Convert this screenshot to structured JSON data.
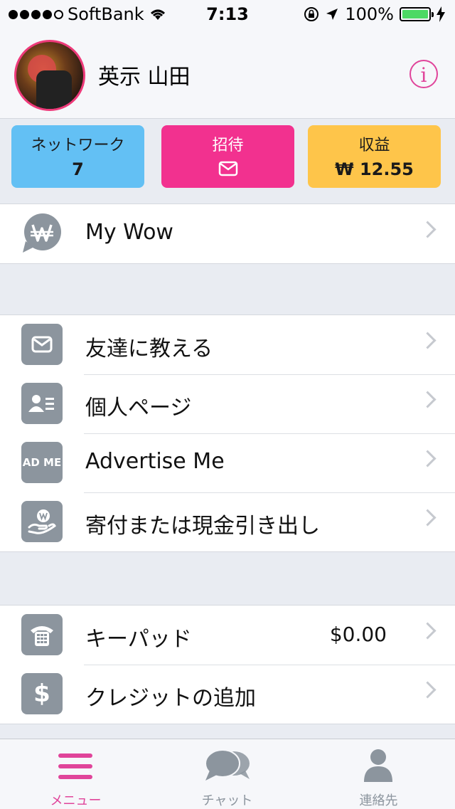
{
  "status_bar": {
    "carrier": "SoftBank",
    "time": "7:13",
    "battery": "100%",
    "signal_dots_filled": 4
  },
  "profile": {
    "name": "英示 山田",
    "info_icon": "i"
  },
  "tiles": {
    "network": {
      "label": "ネットワーク",
      "value": "7"
    },
    "invite": {
      "label": "招待",
      "icon": "envelope-icon"
    },
    "earnings": {
      "label": "収益",
      "value": "₩ 12.55"
    }
  },
  "menu_top": [
    {
      "label": "My Wow",
      "icon": "wow-logo-icon"
    }
  ],
  "menu_main": [
    {
      "label": "友達に教える",
      "icon": "envelope-icon"
    },
    {
      "label": "個人ページ",
      "icon": "profile-card-icon"
    },
    {
      "label": "Advertise Me",
      "icon_text": "AD ME"
    },
    {
      "label": "寄付または現金引き出し",
      "icon": "hand-coin-icon"
    }
  ],
  "menu_bottom": [
    {
      "label": "キーパッド",
      "value": "$0.00",
      "icon": "phone-keypad-icon"
    },
    {
      "label": "クレジットの追加",
      "icon_text": "$"
    }
  ],
  "tabs": [
    {
      "label": "メニュー",
      "icon": "menu-icon",
      "active": true
    },
    {
      "label": "チャット",
      "icon": "chat-icon",
      "active": false
    },
    {
      "label": "連絡先",
      "icon": "contact-icon",
      "active": false
    }
  ],
  "colors": {
    "accent": "#e0449a",
    "network_tile": "#63c0f4",
    "invite_tile": "#f2318f",
    "earnings_tile": "#fec54a",
    "icon_gray": "#8c959e"
  }
}
